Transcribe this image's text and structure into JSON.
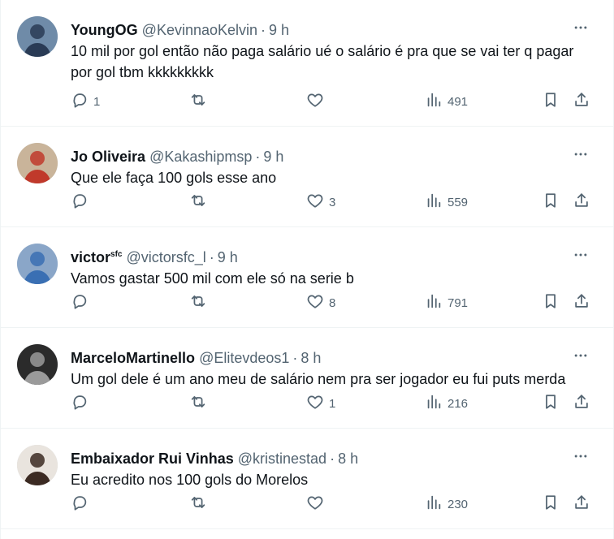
{
  "tweets": [
    {
      "name": "YoungOG",
      "name_sup": "",
      "handle": "@KevinnaoKelvin",
      "time": "9 h",
      "text": "10 mil por gol então não paga salário ué o salário é pra que se vai ter q pagar por gol tbm kkkkkkkkk",
      "replies": "1",
      "retweets": "",
      "likes": "",
      "views": "491",
      "avatar_bg": "#6f8ba8",
      "avatar_fg": "#2a3b55"
    },
    {
      "name": "Jo Oliveira",
      "name_sup": "",
      "handle": "@Kakashipmsp",
      "time": "9 h",
      "text": "Que ele faça 100 gols esse ano",
      "replies": "",
      "retweets": "",
      "likes": "3",
      "views": "559",
      "avatar_bg": "#c9b49a",
      "avatar_fg": "#c0392b"
    },
    {
      "name": "victor",
      "name_sup": "sfc",
      "handle": "@victorsfc_l",
      "time": "9 h",
      "text": "Vamos gastar 500 mil com ele só na serie b",
      "replies": "",
      "retweets": "",
      "likes": "8",
      "views": "791",
      "avatar_bg": "#8aa6c8",
      "avatar_fg": "#3a6fb3"
    },
    {
      "name": "MarceloMartinello",
      "name_sup": "",
      "handle": "@Elitevdeos1",
      "time": "8 h",
      "text": "Um gol dele é um ano meu de salário nem pra ser jogador eu fui puts merda",
      "replies": "",
      "retweets": "",
      "likes": "1",
      "views": "216",
      "avatar_bg": "#2b2b2b",
      "avatar_fg": "#9a9a9a"
    },
    {
      "name": "Embaixador Rui Vinhas",
      "name_sup": "",
      "handle": "@kristinestad",
      "time": "8 h",
      "text": "Eu acredito nos 100 gols do Morelos",
      "replies": "",
      "retweets": "",
      "likes": "",
      "views": "230",
      "avatar_bg": "#e9e4de",
      "avatar_fg": "#3b2a22"
    }
  ],
  "separator": "·"
}
